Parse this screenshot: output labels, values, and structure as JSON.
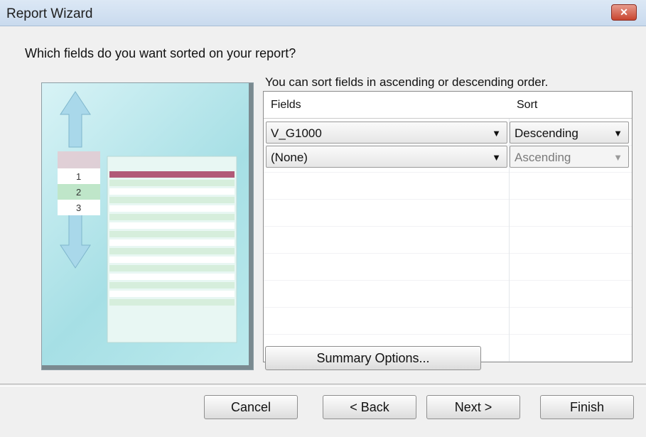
{
  "window": {
    "title": "Report Wizard",
    "close_glyph": "✕"
  },
  "question": "Which fields do you want sorted on your report?",
  "hint": "You can sort fields in ascending or descending order.",
  "table": {
    "headers": {
      "fields": "Fields",
      "sort": "Sort"
    },
    "rows": [
      {
        "field": "V_G1000",
        "sort": "Descending",
        "sort_enabled": true
      },
      {
        "field": "(None)",
        "sort": "Ascending",
        "sort_enabled": false
      }
    ]
  },
  "buttons": {
    "summary": "Summary Options...",
    "cancel": "Cancel",
    "back": "< Back",
    "next": "Next >",
    "finish": "Finish"
  },
  "preview": {
    "steps": [
      "1",
      "2",
      "3"
    ],
    "colors": {
      "arrow": "#9fd2e6",
      "header": "#b15a78"
    }
  }
}
